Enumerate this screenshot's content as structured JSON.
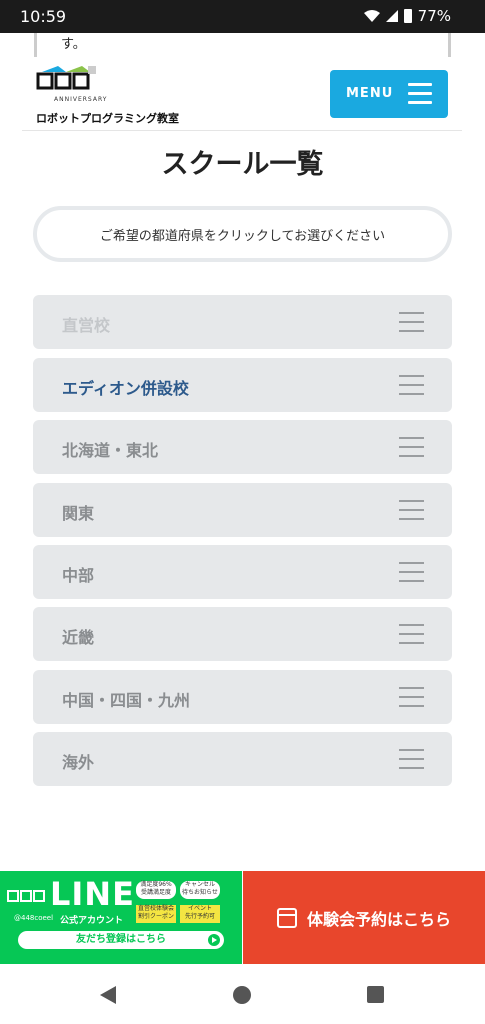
{
  "status": {
    "time": "10:59",
    "battery": "77%"
  },
  "top_fragment": "す。",
  "header": {
    "logo_anniversary": "ANNIVERSARY",
    "logo_subtitle": "ロボットプログラミング教室",
    "menu_label": "MENU"
  },
  "page_title": "スクール一覧",
  "prefecture_button": "ご希望の都道府県をクリックしてお選びください",
  "categories": [
    {
      "label": "直営校"
    },
    {
      "label": "エディオン併設校"
    },
    {
      "label": "北海道・東北"
    },
    {
      "label": "関東"
    },
    {
      "label": "中部"
    },
    {
      "label": "近畿"
    },
    {
      "label": "中国・四国・九州"
    },
    {
      "label": "海外"
    }
  ],
  "line_banner": {
    "brand": "LINE",
    "account_id": "@448coeel",
    "official": "公式アカウント",
    "badge1": "満足度96%",
    "badge1b": "受講満足度",
    "badge2": "キャンセル",
    "badge2b": "待ちお知らせ",
    "tag1": "直営校体験会",
    "tag1b": "割引クーポン",
    "tag2": "イベント",
    "tag2b": "先行予約可",
    "friend_label": "友だち登録はこちら"
  },
  "reserve_label": "体験会予約はこちら",
  "colors": {
    "menu_blue": "#1aa9e0",
    "line_green": "#06c755",
    "reserve_red": "#e8462c",
    "active_text": "#2d5a8c"
  }
}
